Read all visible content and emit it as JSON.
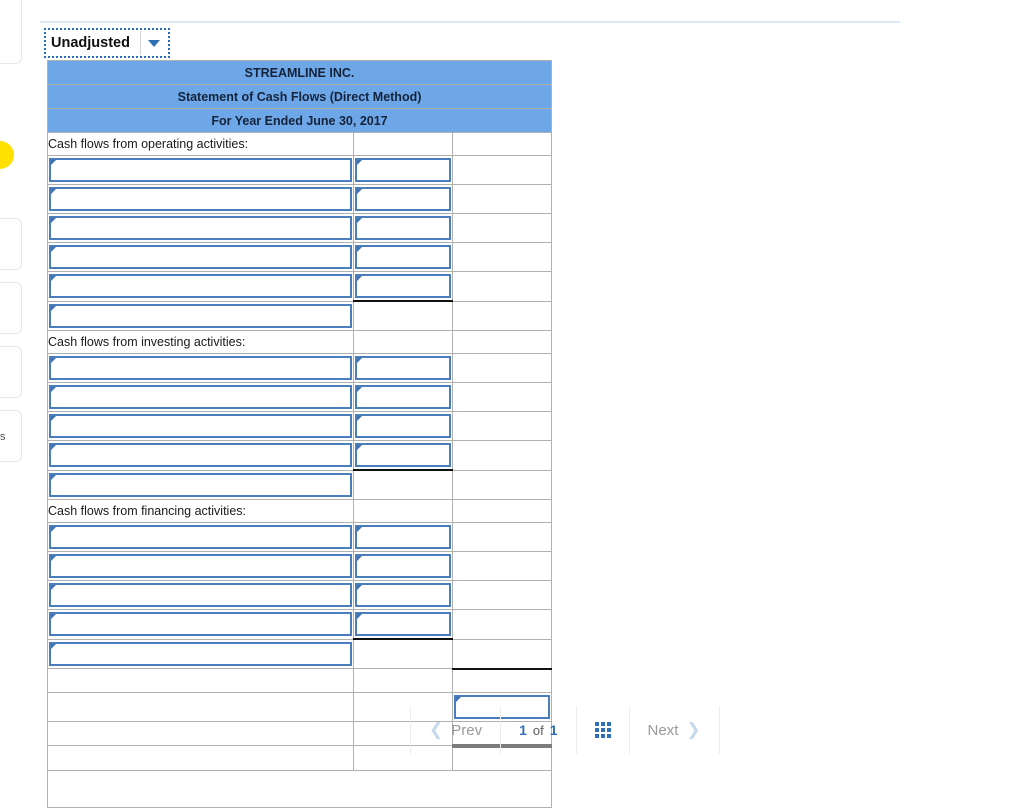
{
  "toolbar": {
    "adjust_selector_value": "Unadjusted",
    "caret_icon": "chevron-down-icon"
  },
  "worksheet": {
    "company_name": "STREAMLINE INC.",
    "statement_title": "Statement of Cash Flows (Direct Method)",
    "period": "For Year Ended June 30, 2017",
    "sections": [
      {
        "label": "Cash flows from operating activities:",
        "input_rows": 5,
        "total_row": true
      },
      {
        "label": "Cash flows from investing activities:",
        "input_rows": 4,
        "total_row": true
      },
      {
        "label": "Cash flows from financing activities:",
        "input_rows": 4,
        "total_row": true
      }
    ]
  },
  "pagination": {
    "prev_label": "Prev",
    "next_label": "Next",
    "current_page": "1",
    "of_label": "of",
    "total_pages": "1",
    "grid_icon": "grid-view-icon",
    "prev_icon": "chevron-left-icon",
    "next_icon": "chevron-right-icon"
  },
  "colors": {
    "header_blue": "#6ea7e8",
    "input_border_blue": "#4a7ebb",
    "accent_blue": "#2f6fb5",
    "highlight_yellow": "#ffe000"
  },
  "left_edge": {
    "clipped_text": "s"
  }
}
